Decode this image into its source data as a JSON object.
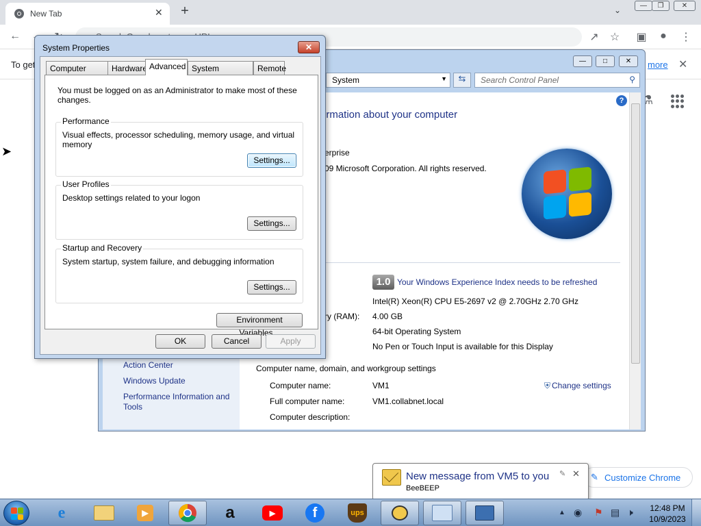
{
  "chrome": {
    "tab_title": "New Tab",
    "tab_close": "✕",
    "new_tab": "+",
    "omnibox_placeholder": "Search Google or type a URL",
    "infobar_text": "To get",
    "infobar_learn_more": "more",
    "infobar_close": "✕",
    "customize_chrome": "Customize Chrome"
  },
  "control_panel": {
    "address": "System",
    "search_placeholder": "Search Control Panel",
    "heading": "ormation about your computer",
    "edition": "erprise",
    "copyright": "09 Microsoft Corporation.  All rights reserved.",
    "wei_score": "1.0",
    "wei_link": "Your Windows Experience Index needs to be refreshed",
    "processor": "Intel(R) Xeon(R) CPU E5-2697 v2 @ 2.70GHz   2.70 GHz",
    "memory_label": "ry (RAM):",
    "memory_value": "4.00 GB",
    "system_type": "64-bit Operating System",
    "pen_touch": "No Pen or Touch Input is available for this Display",
    "see_also": [
      "Action Center",
      "Windows Update",
      "Performance Information and",
      "Tools"
    ],
    "settings_group": "Computer name, domain, and workgroup settings",
    "computer_name_label": "Computer name:",
    "computer_name_value": "VM1",
    "full_name_label": "Full computer name:",
    "full_name_value": "VM1.collabnet.local",
    "description_label": "Computer description:",
    "change_settings": "Change settings",
    "help": "?"
  },
  "system_properties": {
    "title": "System Properties",
    "close": "✕",
    "tabs": [
      "Computer Name",
      "Hardware",
      "Advanced",
      "System Protection",
      "Remote"
    ],
    "active_tab": "Advanced",
    "admin_note": "You must be logged on as an Administrator to make most of these changes.",
    "performance_title": "Performance",
    "performance_desc": "Visual effects, processor scheduling, memory usage, and virtual memory",
    "profiles_title": "User Profiles",
    "profiles_desc": "Desktop settings related to your logon",
    "startup_title": "Startup and Recovery",
    "startup_desc": "System startup, system failure, and debugging information",
    "settings_button": "Settings...",
    "env_button": "Environment Variables...",
    "ok": "OK",
    "cancel": "Cancel",
    "apply": "Apply"
  },
  "notification": {
    "title": "New message from VM5 to you",
    "subtitle": "BeeBEEP",
    "close": "✕"
  },
  "taskbar": {
    "apps": [
      "internet-explorer",
      "windows-explorer",
      "media-player",
      "google-chrome",
      "amazon",
      "youtube",
      "facebook",
      "ups",
      "beebeep",
      "control-panel",
      "system-properties"
    ],
    "time": "12:48 PM",
    "date": "10/9/2023"
  },
  "colors": {
    "cp_link": "#1e3287",
    "chrome_link": "#1a73e8",
    "taskbar": "#6f94c0"
  }
}
